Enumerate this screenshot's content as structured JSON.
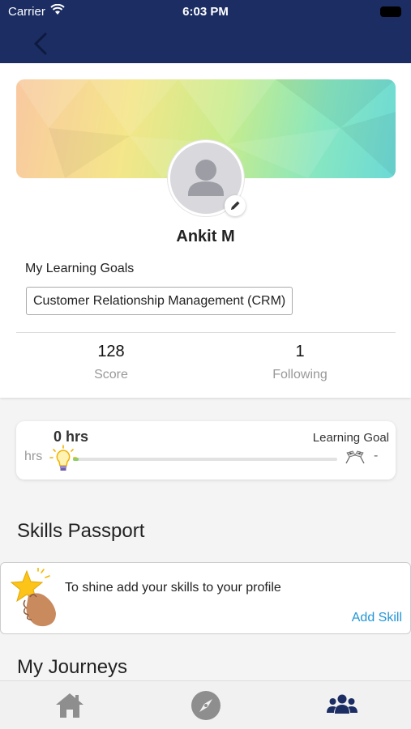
{
  "status_bar": {
    "carrier": "Carrier",
    "time": "6:03 PM"
  },
  "nav": {
    "back_icon": "chevron-left-icon"
  },
  "profile": {
    "name": "Ankit M",
    "goals_label": "My Learning Goals",
    "goal_chip": "Customer Relationship Management (CRM)",
    "stats": [
      {
        "value": "128",
        "label": "Score"
      },
      {
        "value": "1",
        "label": "Following"
      }
    ]
  },
  "progress": {
    "hours_value": "0 hrs",
    "unit_label": "hrs",
    "goal_label": "Learning Goal",
    "goal_value": "-",
    "fill_fraction": 0.02
  },
  "skills": {
    "title": "Skills Passport",
    "message": "To shine add your skills to your profile",
    "action": "Add Skill"
  },
  "journeys": {
    "title": "My Journeys"
  },
  "tabbar": {
    "active_color": "#1b2d63",
    "inactive_color": "#8e8e8e",
    "tabs": [
      {
        "icon": "home-icon",
        "active": false
      },
      {
        "icon": "compass-icon",
        "active": false
      },
      {
        "icon": "people-icon",
        "active": true
      }
    ]
  },
  "colors": {
    "navbar": "#1b2d63",
    "accent": "#2196d6"
  }
}
